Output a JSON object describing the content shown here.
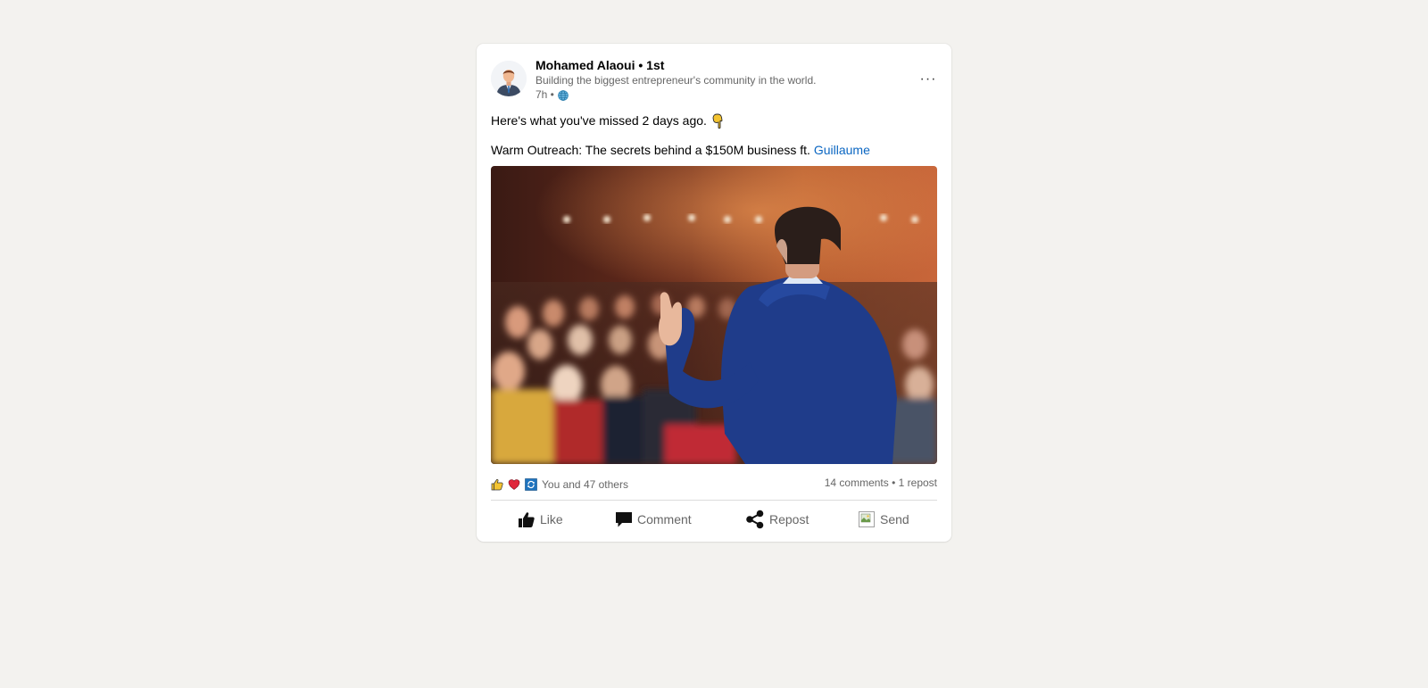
{
  "post": {
    "author": {
      "name": "Mohamed Alaoui • 1st",
      "headline": "Building the biggest entrepreneur's community in the world.",
      "time": "7h •",
      "visibility_icon": "globe-icon"
    },
    "more_label": "···",
    "text_line1": "Here's what you've missed 2 days ago.",
    "text_line1_emoji": "point-down-icon",
    "text_line2": "Warm Outreach: The secrets behind a $150M business ft.",
    "mention": "Guillaume",
    "image": {
      "subject": "speaker-presenting-to-audience"
    },
    "reactions": {
      "icons": [
        "like-icon",
        "heart-icon",
        "insightful-icon"
      ],
      "summary": "You and 47 others"
    },
    "stats": {
      "comments": "14 comments",
      "separator": "•",
      "reposts": "1 repost"
    },
    "actions": {
      "like": "Like",
      "comment": "Comment",
      "repost": "Repost",
      "send": "Send"
    }
  },
  "colors": {
    "background": "#f3f2ef",
    "card": "#ffffff",
    "link": "#0a66c2",
    "muted": "#666666"
  }
}
